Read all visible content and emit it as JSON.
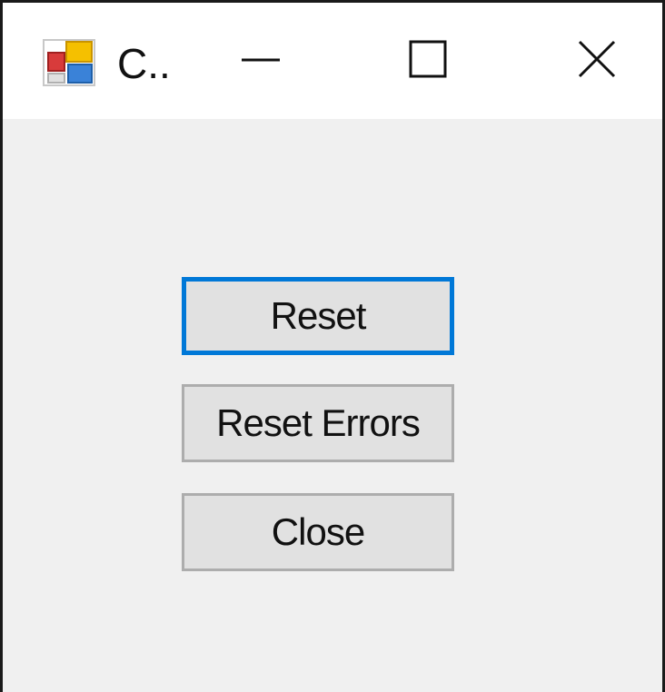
{
  "window": {
    "title": "C.."
  },
  "titlebar": {
    "icon": "form-app-icon",
    "buttons": [
      {
        "name": "minimize",
        "icon": "minimize-icon"
      },
      {
        "name": "maximize",
        "icon": "maximize-icon"
      },
      {
        "name": "close",
        "icon": "close-icon"
      }
    ]
  },
  "buttons": {
    "reset": "Reset",
    "reset_errors": "Reset Errors",
    "close": "Close"
  },
  "colors": {
    "focus_border": "#0078d7",
    "button_face": "#e1e1e1",
    "button_border": "#adadad",
    "client_background": "#f0f0f0"
  },
  "focused_button": "Reset"
}
